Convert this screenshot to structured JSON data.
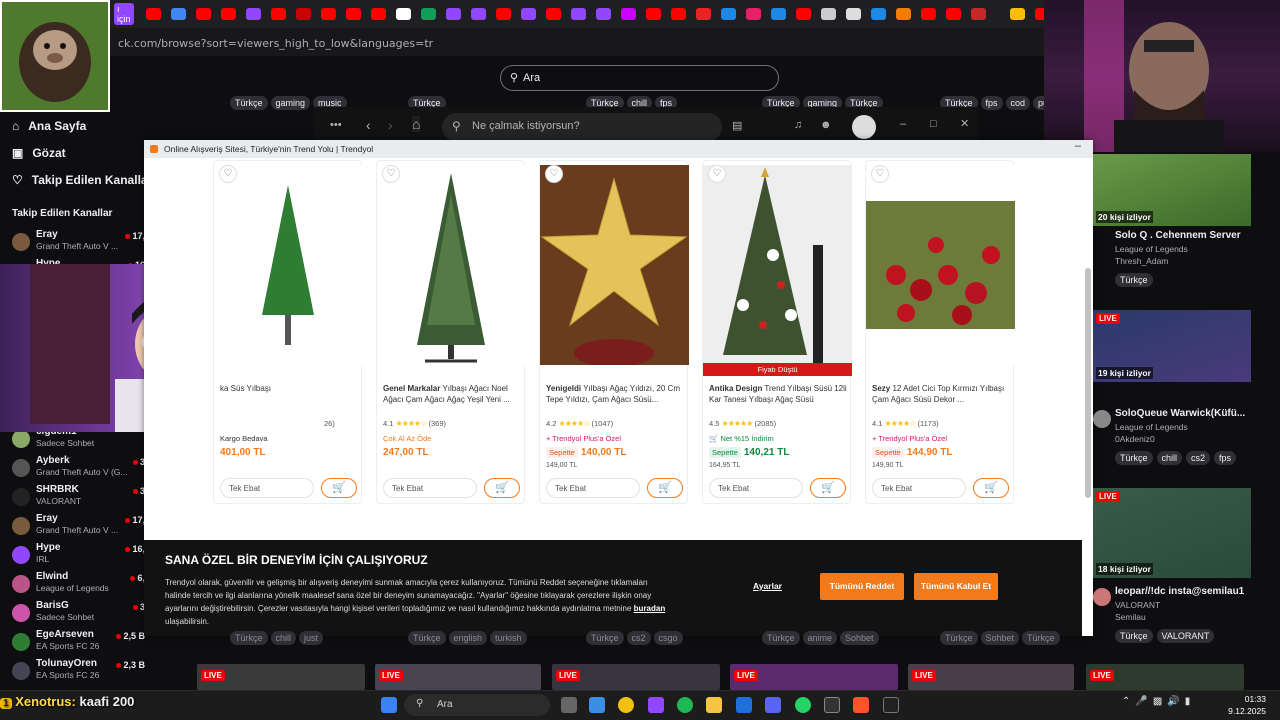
{
  "browser": {
    "url": "ck.com/browse?sort=viewers_high_to_low&languages=tr",
    "bookmark_first": "ı için"
  },
  "twitch": {
    "search_placeholder": "Ara",
    "top_tags": [
      [
        "Türkçe",
        "gaming",
        "music"
      ],
      [
        "Türkçe"
      ],
      [
        "Türkçe",
        "chill",
        "fps"
      ],
      [
        "Türkçe",
        "gaming",
        "Türkçe"
      ],
      [
        "Türkçe",
        "fps",
        "cod",
        "pu"
      ]
    ],
    "nav": [
      "Ana Sayfa",
      "Gözat",
      "Takip Edilen Kanallar"
    ],
    "followed_title": "Takip Edilen Kanallar",
    "channels": [
      {
        "name": "Eray",
        "game": "Grand Theft Auto V ...",
        "viewers": "17,"
      },
      {
        "name": "Hype",
        "game": "",
        "viewers": "16"
      },
      {
        "name": "cigdem1",
        "game": "Sadece Sohbet",
        "viewers": ""
      },
      {
        "name": "Ayberk",
        "game": "Grand Theft Auto V (G...",
        "viewers": "3"
      },
      {
        "name": "SHRBRK",
        "game": "VALORANT",
        "viewers": "3"
      },
      {
        "name": "Eray",
        "game": "Grand Theft Auto V ...",
        "viewers": "17,"
      },
      {
        "name": "Hype",
        "game": "IRL",
        "viewers": "16,"
      },
      {
        "name": "Elwind",
        "game": "League of Legends",
        "viewers": "6,"
      },
      {
        "name": "BarisG",
        "game": "Sadece Sohbet",
        "viewers": "3"
      },
      {
        "name": "EgeArseven",
        "game": "EA Sports FC 26",
        "viewers": "2,5 B"
      },
      {
        "name": "TolunayOren",
        "game": "EA Sports FC 26",
        "viewers": "2,3 B"
      }
    ],
    "right_streams": [
      {
        "viewers": "20 kişi izliyor",
        "title": "Solo Q . Cehennem Server",
        "game": "League of Legends",
        "user": "Thresh_Adam",
        "tags": [
          "Türkçe"
        ],
        "live": ""
      },
      {
        "viewers": "19 kişi izliyor",
        "title": "SoloQueue Warwick(Küfü...",
        "game": "League of Legends",
        "user": "0Akdeniz0",
        "tags": [
          "Türkçe",
          "chill",
          "cs2",
          "fps"
        ],
        "live": "LIVE"
      },
      {
        "viewers": "18 kişi izliyor",
        "title": "leopar//!dc insta@semilau1",
        "game": "VALORANT",
        "user": "Semilau",
        "tags": [
          "Türkçe",
          "VALORANT"
        ],
        "live": "LIVE"
      }
    ],
    "bottom_tags": [
      [
        "Türkçe",
        "chill",
        "just"
      ],
      [
        "Türkçe",
        "english",
        "turkish"
      ],
      [
        "Türkçe",
        "cs2",
        "csgo"
      ],
      [
        "Türkçe",
        "anime",
        "Sohbet"
      ],
      [
        "Türkçe",
        "Sohbet",
        "Türkçe"
      ]
    ],
    "live_label": "LIVE"
  },
  "spotify": {
    "search_placeholder": "Ne çalmak istiyorsun?"
  },
  "shop_window": {
    "title": "Online Alışveriş Sitesi, Türkiye'nin Trend Yolu | Trendyol",
    "minimize": "–",
    "products": [
      {
        "brand": "",
        "title": "ka Süs Yılbaşı",
        "rating": "",
        "reviews": "26)",
        "promo": "Kargo Bedava",
        "promo_color": "#333",
        "price": "401,00 TL",
        "old_price": "",
        "sepette": false,
        "badge": "",
        "select": "Tek Ebat"
      },
      {
        "brand": "Genel Markalar",
        "title": "Yılbaşı Ağacı Noel Ağacı Çam Ağacı Ağaç Yeşil Yeni ...",
        "rating": "4.1",
        "reviews": "(369)",
        "promo": "Çok Al Az Öde",
        "promo_color": "#f27a1a",
        "price": "247,00 TL",
        "old_price": "",
        "sepette": false,
        "badge": "",
        "select": "Tek Ebat"
      },
      {
        "brand": "Yenigeldi",
        "title": "Yılbaşı Ağaç Yıldızı, 20 Cm Tepe Yıldızı, Çam Ağacı Süsü...",
        "rating": "4.2",
        "reviews": "(1047)",
        "promo": "Trendyol Plus'a Özel",
        "promo_color": "#d6186f",
        "price": "140,00 TL",
        "old_price": "149,00 TL",
        "sepette": true,
        "badge": "",
        "select": "Tek Ebat"
      },
      {
        "brand": "Antika Design",
        "title": "Trend Yılbaşı Süsü 12li Kar Tanesi Yılbaşı Ağaç Süsü",
        "rating": "4.5",
        "reviews": "(2085)",
        "promo": "Net %15 İndirim",
        "promo_color": "#0b8a3b",
        "price": "140,21 TL",
        "old_price": "164,95 TL",
        "sepette": true,
        "badge": "Fiyatı Düştü",
        "select": "Tek Ebat"
      },
      {
        "brand": "Sezy",
        "title": "12 Adet Cici Top Kırmızı Yılbaşı Çam Ağacı Süsü Dekor ...",
        "rating": "4.1",
        "reviews": "(1173)",
        "promo": "Trendyol Plus'a Özel",
        "promo_color": "#d6186f",
        "price": "144,90 TL",
        "old_price": "149,90 TL",
        "sepette": true,
        "badge": "",
        "select": "Tek Ebat"
      }
    ],
    "sepette_label": "Sepette",
    "cookie": {
      "heading": "SANA ÖZEL BİR DENEYİM İÇİN ÇALIŞIYORUZ",
      "text": "Trendyol olarak, güvenilir ve gelişmiş bir alışveriş deneyimi sunmak amacıyla çerez kullanıyoruz. Tümünü Reddet seçeneğine tıklamaları halinde tercih ve ilgi alanlarına yönelik maalesef sana özel bir deneyim sunamayacağız. \"Ayarlar\" öğesine tıklayarak çerezlere ilişkin onay ayarlarını değiştirebilirsin. Çerezler vasıtasıyla hangi kişisel verileri topladığımız ve nasıl kullandığımız hakkında aydınlatma metnine",
      "link": "buradan",
      "tail": "ulaşabilirsin.",
      "settings": "Ayarlar",
      "reject": "Tümünü Reddet",
      "accept": "Tümünü Kabul Et"
    }
  },
  "overlay": {
    "chat_user": "Xenotrus:",
    "chat_message": "kaafi 200",
    "chat_rank": "1"
  },
  "taskbar": {
    "search": "Ara",
    "time": "01:33",
    "date": "9.12.2025"
  },
  "colors": {
    "trendyol_orange": "#f27a1a",
    "twitch_live": "#eb0400",
    "twitch_bg": "#0e0e10"
  }
}
